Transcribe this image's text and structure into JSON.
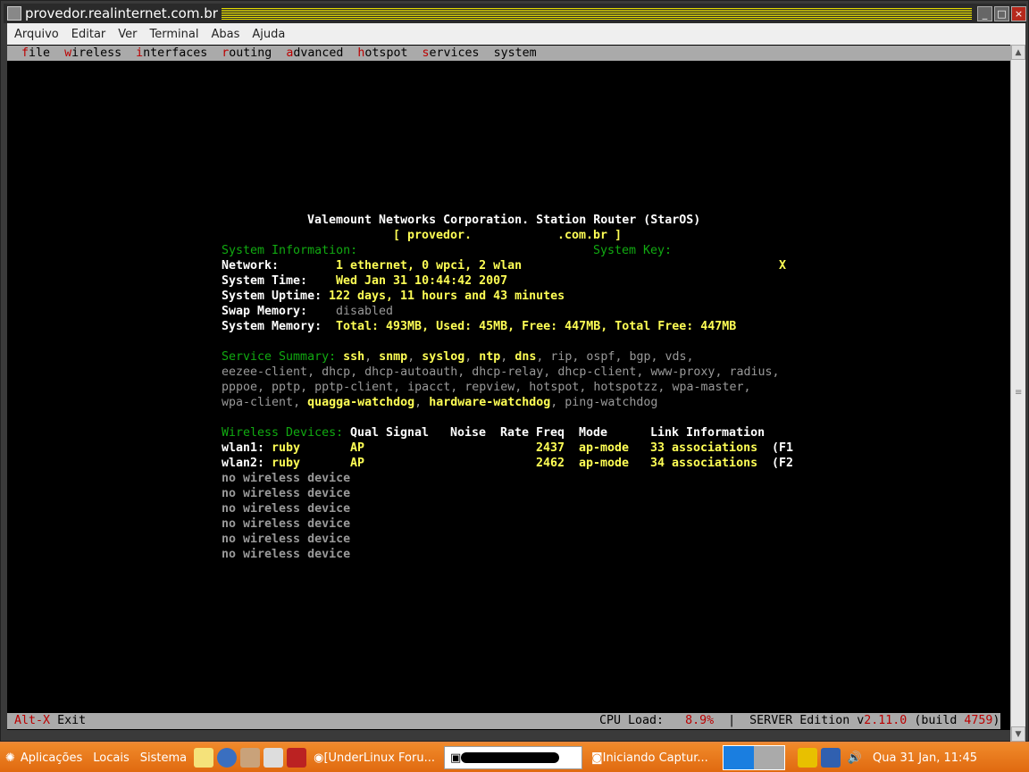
{
  "window": {
    "title": "provedor.realinternet.com.br"
  },
  "menu": [
    "Arquivo",
    "Editar",
    "Ver",
    "Terminal",
    "Abas",
    "Ajuda"
  ],
  "tmenu": [
    {
      "hk": "f",
      "rest": "ile"
    },
    {
      "hk": "w",
      "rest": "ireless"
    },
    {
      "hk": "i",
      "rest": "nterfaces"
    },
    {
      "hk": "r",
      "rest": "outing"
    },
    {
      "hk": "a",
      "rest": "dvanced"
    },
    {
      "hk": "h",
      "rest": "otspot"
    },
    {
      "hk": "s",
      "rest": "ervices"
    },
    {
      "hk": "sy",
      "rest": "stem"
    }
  ],
  "header": {
    "title": "Valemount Networks Corporation. Station Router (StarOS)",
    "host_left": "[ provedor.",
    "host_right": ".com.br ]"
  },
  "sysinfo": {
    "label": "System Information:",
    "key_label": "System Key:",
    "key_value": "X",
    "rows": [
      {
        "k": "Network:",
        "v": "1 ethernet, 0 wpci, 2 wlan"
      },
      {
        "k": "System Time:",
        "v": "Wed Jan 31 10:44:42 2007"
      },
      {
        "k": "System Uptime:",
        "v": "122 days, 11 hours and 43 minutes"
      },
      {
        "k": "Swap Memory:",
        "v": "disabled"
      },
      {
        "k": "System Memory:",
        "v": "Total: 493MB, Used: 45MB, Free: 447MB, Total Free: 447MB"
      }
    ]
  },
  "services": {
    "label": "Service Summary:",
    "lines": [
      [
        {
          "n": "ssh",
          "on": true
        },
        {
          "n": "snmp",
          "on": true
        },
        {
          "n": "syslog",
          "on": true
        },
        {
          "n": "ntp",
          "on": true
        },
        {
          "n": "dns",
          "on": true
        },
        {
          "n": "rip",
          "on": false
        },
        {
          "n": "ospf",
          "on": false
        },
        {
          "n": "bgp",
          "on": false
        },
        {
          "n": "vds",
          "on": false
        }
      ],
      [
        {
          "n": "eezee-client",
          "on": false
        },
        {
          "n": "dhcp",
          "on": false
        },
        {
          "n": "dhcp-autoauth",
          "on": false
        },
        {
          "n": "dhcp-relay",
          "on": false
        },
        {
          "n": "dhcp-client",
          "on": false
        },
        {
          "n": "www-proxy",
          "on": false
        },
        {
          "n": "radius",
          "on": false
        }
      ],
      [
        {
          "n": "pppoe",
          "on": false
        },
        {
          "n": "pptp",
          "on": false
        },
        {
          "n": "pptp-client",
          "on": false
        },
        {
          "n": "ipacct",
          "on": false
        },
        {
          "n": "repview",
          "on": false
        },
        {
          "n": "hotspot",
          "on": false
        },
        {
          "n": "hotspotzz",
          "on": false
        },
        {
          "n": "wpa-master",
          "on": false
        }
      ],
      [
        {
          "n": "wpa-client",
          "on": false
        },
        {
          "n": "quagga-watchdog",
          "on": true
        },
        {
          "n": "hardware-watchdog",
          "on": true
        },
        {
          "n": "ping-watchdog",
          "on": false,
          "last": true
        }
      ]
    ]
  },
  "wireless": {
    "label": "Wireless Devices:",
    "cols": [
      "Qual",
      "Signal",
      "Noise",
      "Rate",
      "Freq",
      "Mode",
      "Link Information"
    ],
    "devices": [
      {
        "name": "wlan1:",
        "type": "ruby",
        "qual": "AP",
        "freq": "2437",
        "mode": "ap-mode",
        "link": "33 associations",
        "extra": "(F1"
      },
      {
        "name": "wlan2:",
        "type": "ruby",
        "qual": "AP",
        "freq": "2462",
        "mode": "ap-mode",
        "link": "34 associations",
        "extra": "(F2"
      }
    ],
    "empty": [
      "no wireless device",
      "no wireless device",
      "no wireless device",
      "no wireless device",
      "no wireless device",
      "no wireless device"
    ]
  },
  "status": {
    "key": "Alt-X",
    "action": "Exit",
    "cpu_label": "CPU Load:",
    "cpu": "8.9%",
    "sep": "|",
    "edition": "SERVER Edition v",
    "version": "2.11.0",
    "build_label": "(build",
    "build": "4759",
    "build_end": ")"
  },
  "taskbar": {
    "menus": [
      "Aplicações",
      "Locais",
      "Sistema"
    ],
    "tasks": [
      "[UnderLinux Foru...",
      "Iniciando Captur..."
    ],
    "clock": "Qua 31 Jan, 11:45"
  }
}
